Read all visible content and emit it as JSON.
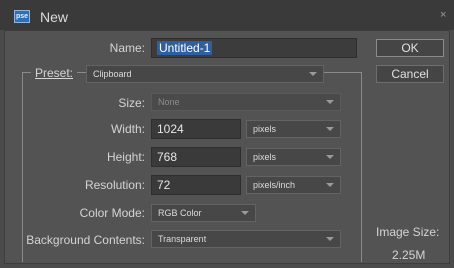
{
  "window": {
    "title": "New",
    "app_icon_text": "pse",
    "close_glyph": "×"
  },
  "name": {
    "label": "Name:",
    "value": "Untitled-1"
  },
  "preset": {
    "label": "Preset:",
    "value": "Clipboard"
  },
  "size": {
    "label": "Size:",
    "value": "None"
  },
  "width": {
    "label": "Width:",
    "value": "1024",
    "unit": "pixels"
  },
  "height": {
    "label": "Height:",
    "value": "768",
    "unit": "pixels"
  },
  "resolution": {
    "label": "Resolution:",
    "value": "72",
    "unit": "pixels/inch"
  },
  "color_mode": {
    "label": "Color Mode:",
    "value": "RGB Color"
  },
  "background": {
    "label": "Background Contents:",
    "value": "Transparent"
  },
  "buttons": {
    "ok": "OK",
    "cancel": "Cancel"
  },
  "image_size": {
    "label": "Image Size:",
    "value": "2.25M"
  }
}
